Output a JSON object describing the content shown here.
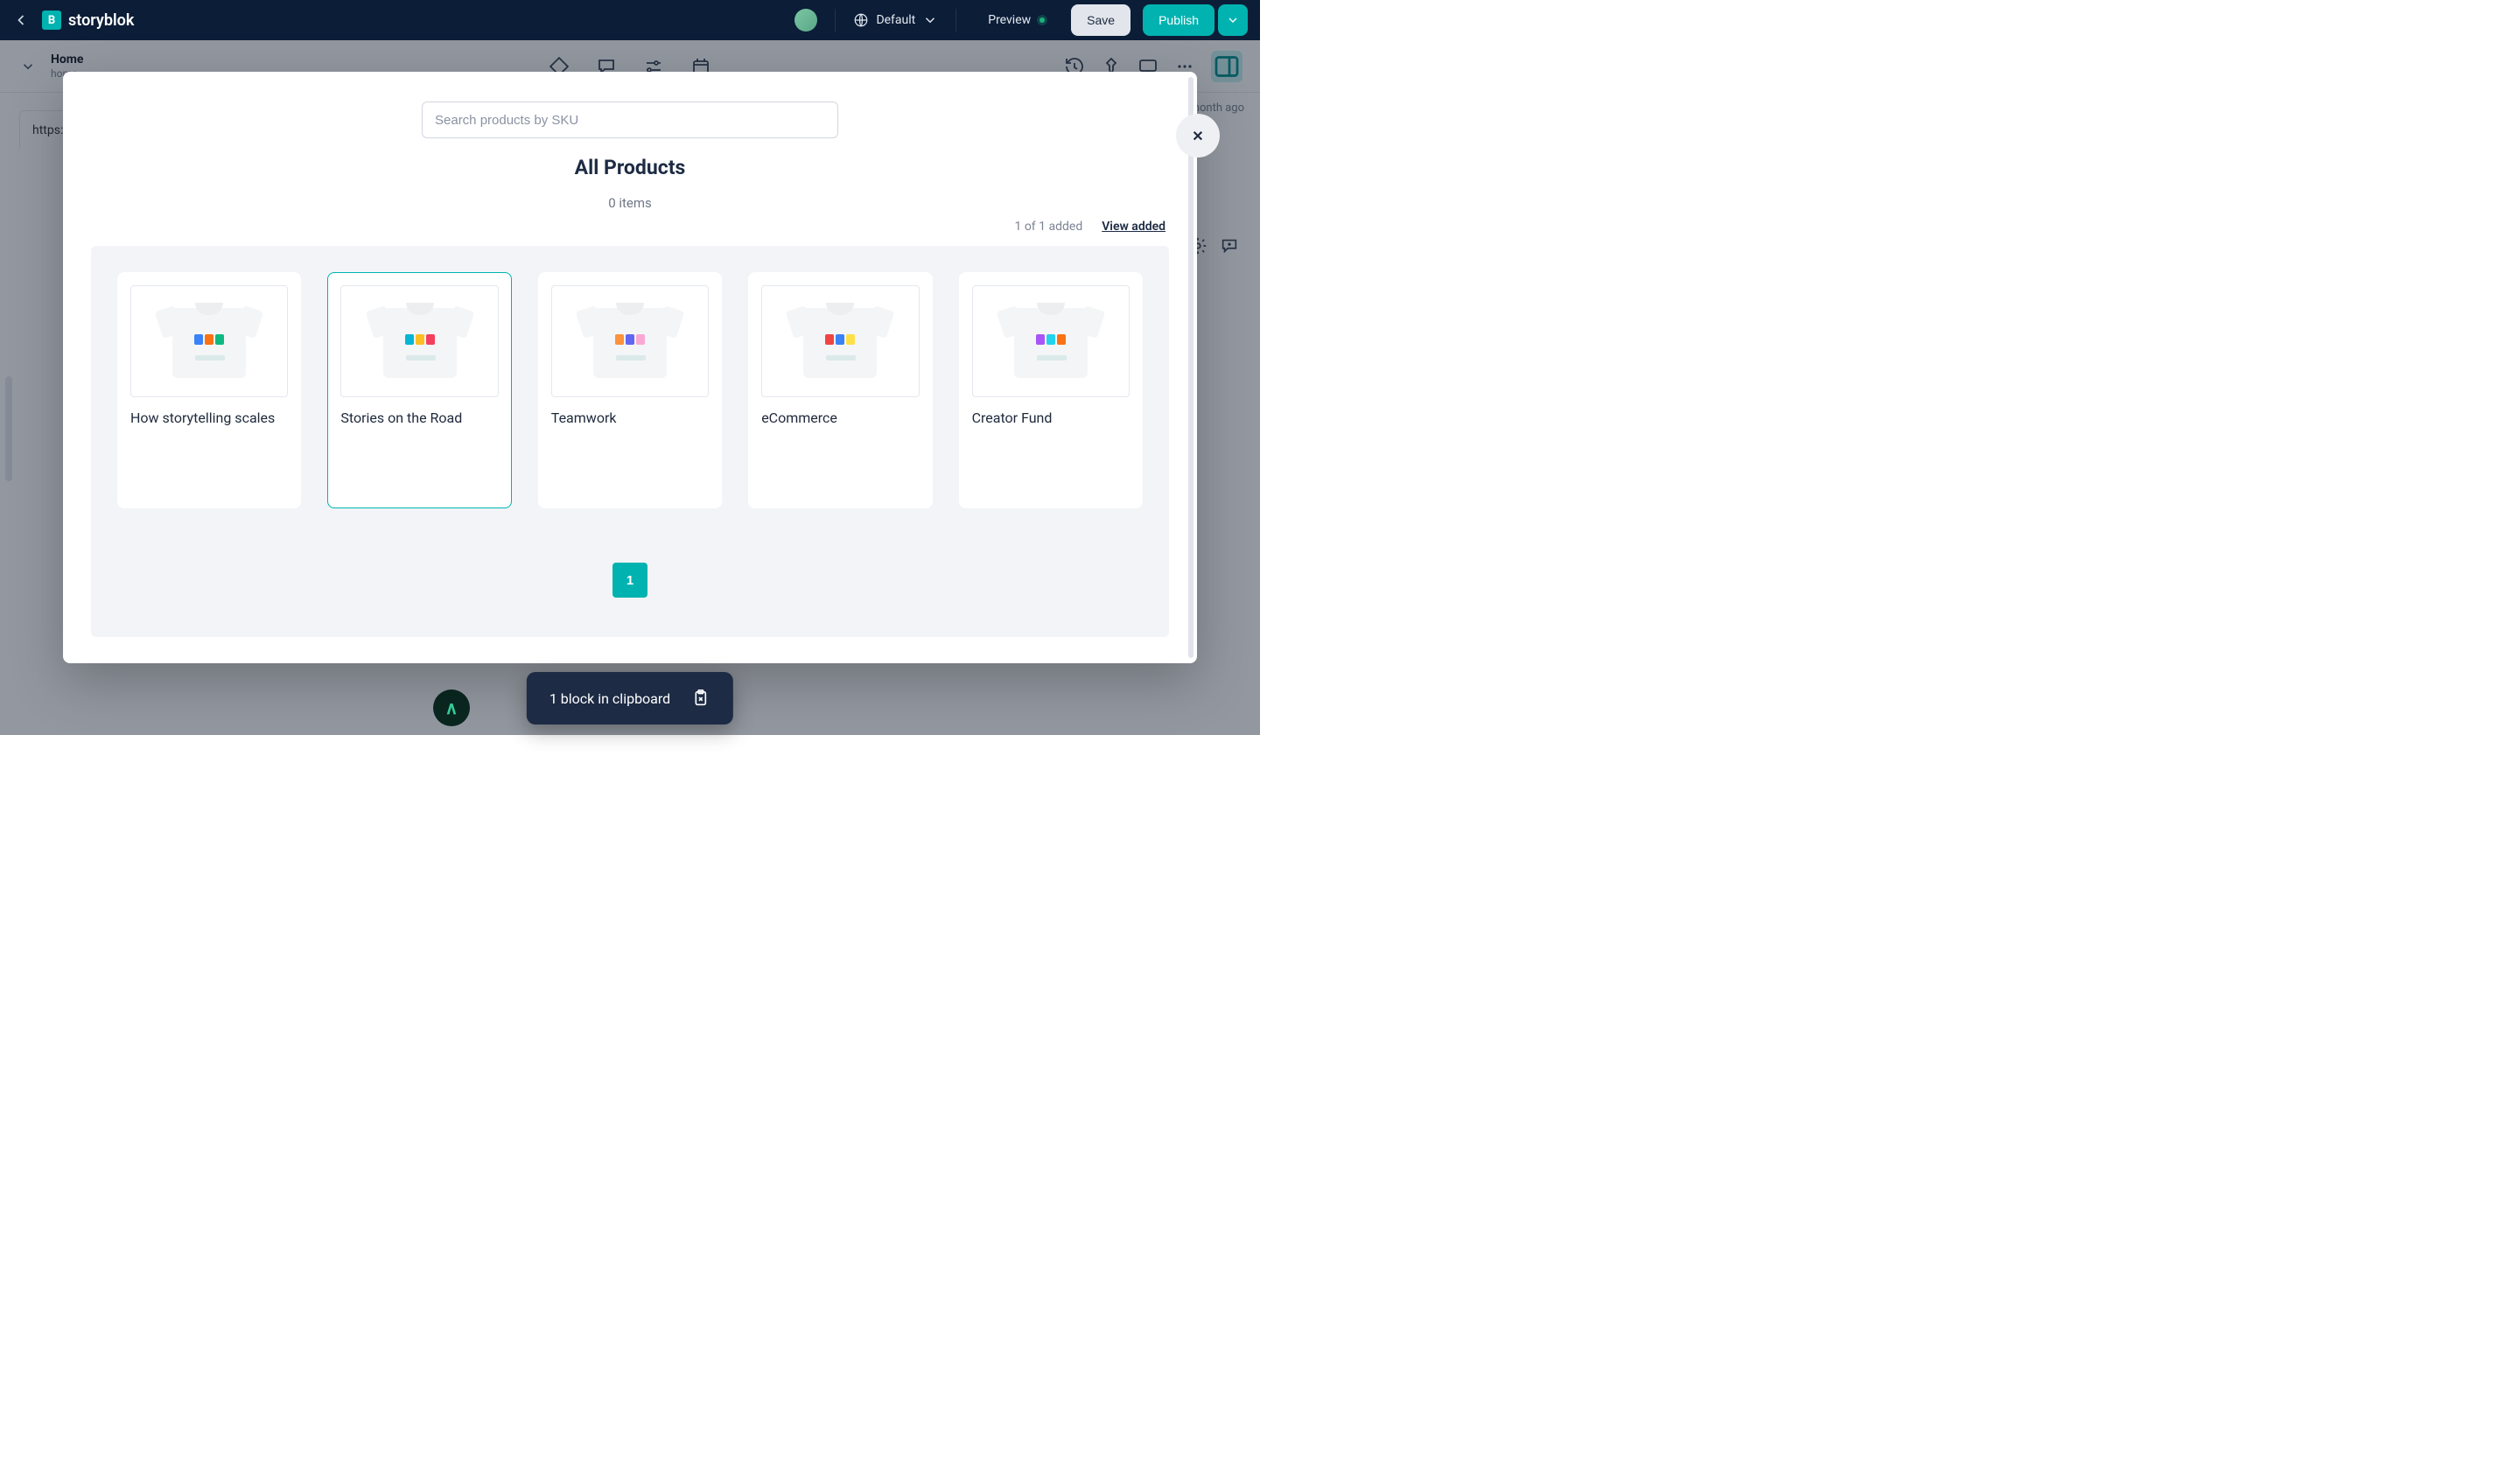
{
  "header": {
    "brand": "storyblok",
    "brand_letter": "B",
    "language_label": "Default",
    "preview_label": "Preview",
    "save_label": "Save",
    "publish_label": "Publish"
  },
  "entry": {
    "title": "Home",
    "slug": "home",
    "updated_suffix": "month ago",
    "url_prefix": "https:/"
  },
  "modal": {
    "search_placeholder": "Search products by SKU",
    "title": "All Products",
    "items_count_text": "0 items",
    "added_text": "1 of 1 added",
    "view_added_label": "View added",
    "close_glyph": "✕",
    "page_label": "1"
  },
  "products": [
    {
      "name": "How storytelling scales",
      "selected": false,
      "art": "c1"
    },
    {
      "name": "Stories on the Road",
      "selected": true,
      "art": "c2"
    },
    {
      "name": "Teamwork",
      "selected": false,
      "art": "c3"
    },
    {
      "name": "eCommerce",
      "selected": false,
      "art": "c4"
    },
    {
      "name": "Creator Fund",
      "selected": false,
      "art": "c5"
    }
  ],
  "toast": {
    "text": "1 block in clipboard"
  }
}
